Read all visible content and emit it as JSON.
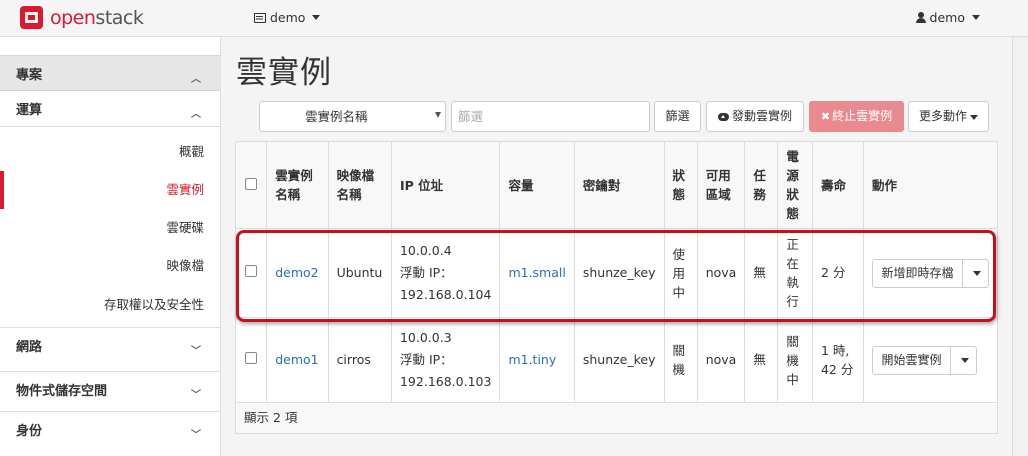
{
  "nav": {
    "brand_open": "open",
    "brand_stack": "stack",
    "project": "demo",
    "user": "demo"
  },
  "sidebar": {
    "project": "專案",
    "compute": "運算",
    "items": [
      {
        "label": "概觀"
      },
      {
        "label": "雲實例"
      },
      {
        "label": "雲硬碟"
      },
      {
        "label": "映像檔"
      },
      {
        "label": "存取權以及安全性"
      }
    ],
    "network": "網路",
    "object_storage": "物件式儲存空間",
    "identity": "身份"
  },
  "page": {
    "title": "雲實例"
  },
  "toolbar": {
    "select_value": "雲實例名稱",
    "filter_placeholder": "篩選",
    "filter_button": "篩選",
    "launch_button": "發動雲實例",
    "terminate_button": "終止雲實例",
    "more_button": "更多動作"
  },
  "table": {
    "headers": [
      "雲實例名稱",
      "映像檔名稱",
      "IP 位址",
      "容量",
      "密鑰對",
      "狀態",
      "可用區域",
      "任務",
      "電源狀態",
      "壽命",
      "動作"
    ],
    "rows": [
      {
        "name": "demo2",
        "image": "Ubuntu",
        "ip1": "10.0.0.4",
        "ip2": "浮動 IP：",
        "ip3": "192.168.0.104",
        "flavor": "m1.small",
        "keypair": "shunze_key",
        "status": "使用中",
        "az": "nova",
        "task": "無",
        "power": "正在執行",
        "age": "2 分",
        "action": "新增即時存檔"
      },
      {
        "name": "demo1",
        "image": "cirros",
        "ip1": "10.0.0.3",
        "ip2": "浮動 IP：",
        "ip3": "192.168.0.103",
        "flavor": "m1.tiny",
        "keypair": "shunze_key",
        "status": "關機",
        "az": "nova",
        "task": "無",
        "power": "關機中",
        "age": "1 時, 42 分",
        "action": "開始雲實例"
      }
    ],
    "footer": "顯示 2 項"
  }
}
